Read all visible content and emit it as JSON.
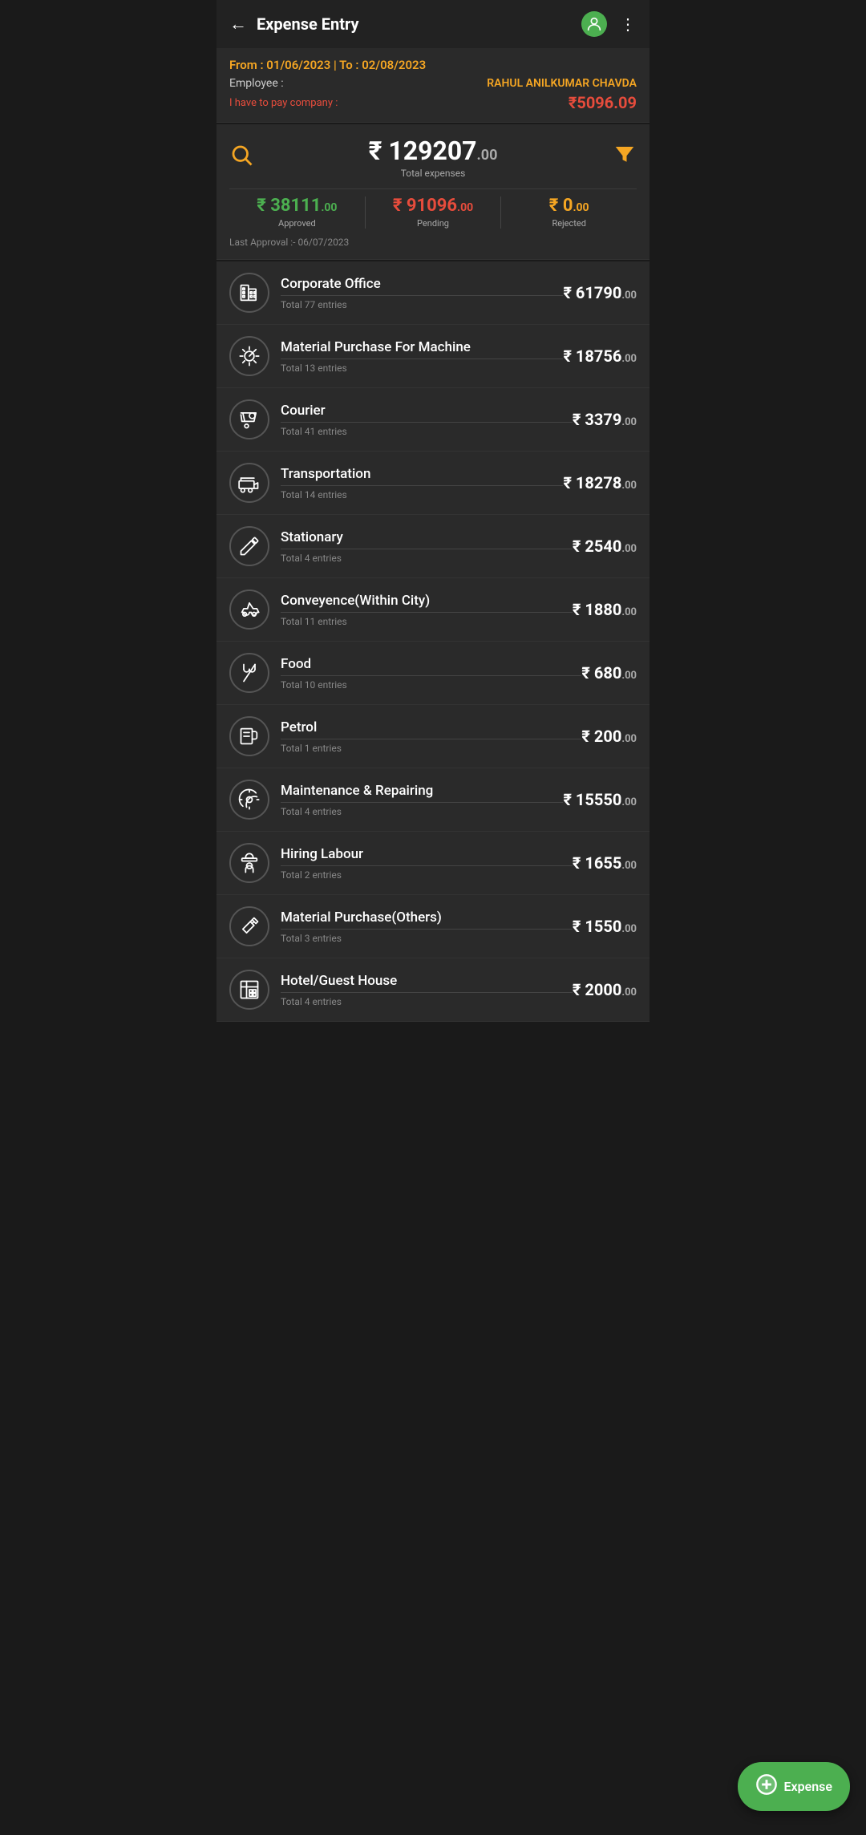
{
  "header": {
    "title": "Expense Entry",
    "back_icon": "←",
    "more_icon": "⋮",
    "avatar_icon": "👤"
  },
  "info_banner": {
    "date_range": "From : 01/06/2023 | To : 02/08/2023",
    "employee_label": "Employee :",
    "employee_name": "RAHUL ANILKUMAR CHAVDA",
    "pay_label": "I have to pay company :",
    "pay_amount": "₹5096.09"
  },
  "summary": {
    "total_amount": "₹ 129207",
    "total_decimal": ".00",
    "total_label": "Total expenses",
    "approved_amount": "₹ 38111",
    "approved_decimal": ".00",
    "approved_label": "Approved",
    "pending_amount": "₹ 91096",
    "pending_decimal": ".00",
    "pending_label": "Pending",
    "rejected_amount": "₹ 0",
    "rejected_decimal": ".00",
    "rejected_label": "Rejected",
    "last_approval": "Last Approval :- 06/07/2023"
  },
  "categories": [
    {
      "name": "Corporate Office",
      "entries": "Total 77 entries",
      "amount": "₹ 61790",
      "decimal": ".00",
      "icon_type": "building"
    },
    {
      "name": "Material Purchase For Machine",
      "entries": "Total 13 entries",
      "amount": "₹ 18756",
      "decimal": ".00",
      "icon_type": "machine"
    },
    {
      "name": "Courier",
      "entries": "Total 41 entries",
      "amount": "₹ 3379",
      "decimal": ".00",
      "icon_type": "courier"
    },
    {
      "name": "Transportation",
      "entries": "Total 14 entries",
      "amount": "₹ 18278",
      "decimal": ".00",
      "icon_type": "transport"
    },
    {
      "name": "Stationary",
      "entries": "Total 4 entries",
      "amount": "₹ 2540",
      "decimal": ".00",
      "icon_type": "pencil"
    },
    {
      "name": "Conveyence(Within City)",
      "entries": "Total 11 entries",
      "amount": "₹ 1880",
      "decimal": ".00",
      "icon_type": "scooter"
    },
    {
      "name": "Food",
      "entries": "Total 10 entries",
      "amount": "₹ 680",
      "decimal": ".00",
      "icon_type": "food"
    },
    {
      "name": "Petrol",
      "entries": "Total 1 entries",
      "amount": "₹ 200",
      "decimal": ".00",
      "icon_type": "petrol"
    },
    {
      "name": "Maintenance & Repairing",
      "entries": "Total 4 entries",
      "amount": "₹ 15550",
      "decimal": ".00",
      "icon_type": "maintenance"
    },
    {
      "name": "Hiring Labour",
      "entries": "Total 2 entries",
      "amount": "₹ 1655",
      "decimal": ".00",
      "icon_type": "labour"
    },
    {
      "name": "Material Purchase(Others)",
      "entries": "Total 3 entries",
      "amount": "₹ 1550",
      "decimal": ".00",
      "icon_type": "hammer"
    },
    {
      "name": "Hotel/Guest House",
      "entries": "Total 4 entries",
      "amount": "₹ 2000",
      "decimal": ".00",
      "icon_type": "hotel"
    }
  ],
  "fab": {
    "icon": "+",
    "label": "Expense"
  }
}
